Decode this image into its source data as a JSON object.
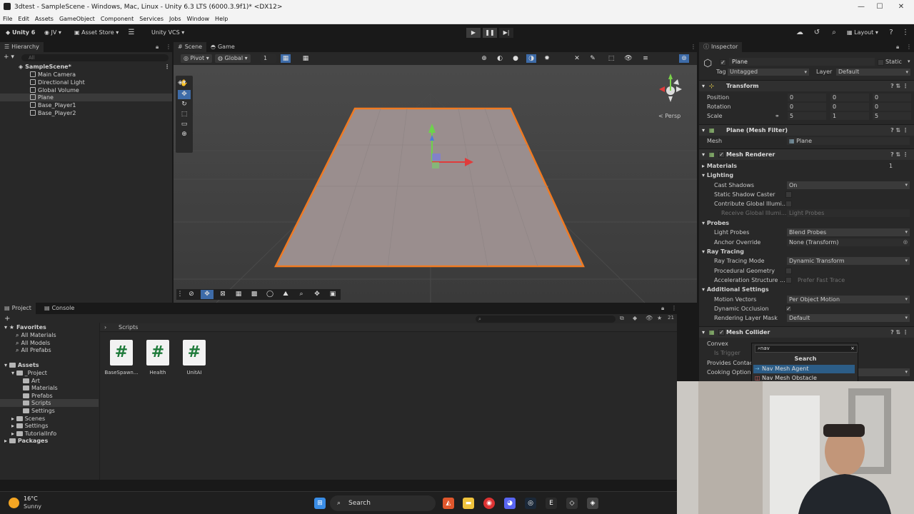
{
  "os": {
    "window_title": "3dtest - SampleScene - Windows, Mac, Linux - Unity 6.3 LTS (6000.3.9f1)* <DX12>",
    "menu": [
      "File",
      "Edit",
      "Assets",
      "GameObject",
      "Component",
      "Services",
      "Jobs",
      "Window",
      "Help"
    ]
  },
  "toolbar": {
    "unity_label": "Unity 6",
    "account_label": "JV",
    "asset_store_label": "Asset Store",
    "vcs_label": "Unity VCS",
    "layout_label": "Layout"
  },
  "hierarchy": {
    "tab_label": "Hierarchy",
    "search_placeholder": "All",
    "scene_name": "SampleScene*",
    "items": [
      "Main Camera",
      "Directional Light",
      "Global Volume",
      "Plane",
      "Base_Player1",
      "Base_Player2"
    ],
    "selected": "Plane"
  },
  "scene_view": {
    "tabs": [
      "Scene",
      "Game"
    ],
    "pivot_label": "Pivot",
    "global_label": "Global",
    "grid_count": "1",
    "persp_label": "< Persp"
  },
  "inspector": {
    "tab_label": "Inspector",
    "object_name": "Plane",
    "static_label": "Static",
    "tag_label": "Tag",
    "tag_value": "Untagged",
    "layer_label": "Layer",
    "layer_value": "Default",
    "transform": {
      "title": "Transform",
      "position_label": "Position",
      "rotation_label": "Rotation",
      "scale_label": "Scale",
      "position": [
        "0",
        "0",
        "0"
      ],
      "rotation": [
        "0",
        "0",
        "0"
      ],
      "scale": [
        "5",
        "1",
        "5"
      ]
    },
    "mesh_filter": {
      "title": "Plane (Mesh Filter)",
      "mesh_label": "Mesh",
      "mesh_value": "Plane"
    },
    "mesh_renderer": {
      "title": "Mesh Renderer",
      "materials_label": "Materials",
      "materials_count": "1",
      "lighting_label": "Lighting",
      "cast_shadows_label": "Cast Shadows",
      "cast_shadows_value": "On",
      "static_shadow_label": "Static Shadow Caster",
      "contribute_gi_label": "Contribute Global Illumi...",
      "receive_gi_label": "Receive Global Illumi...",
      "receive_gi_value": "Light Probes",
      "probes_label": "Probes",
      "light_probes_label": "Light Probes",
      "light_probes_value": "Blend Probes",
      "anchor_override_label": "Anchor Override",
      "anchor_override_value": "None (Transform)",
      "ray_tracing_label": "Ray Tracing",
      "ray_tracing_mode_label": "Ray Tracing Mode",
      "ray_tracing_mode_value": "Dynamic Transform",
      "procedural_geometry_label": "Procedural Geometry",
      "accel_structure_label": "Acceleration Structure ...",
      "accel_structure_value": "Prefer Fast Trace",
      "additional_label": "Additional Settings",
      "motion_vectors_label": "Motion Vectors",
      "motion_vectors_value": "Per Object Motion",
      "dynamic_occlusion_label": "Dynamic Occlusion",
      "rendering_layer_label": "Rendering Layer Mask",
      "rendering_layer_value": "Default"
    },
    "mesh_collider": {
      "title": "Mesh Collider",
      "convex_label": "Convex",
      "is_trigger_label": "Is Trigger",
      "provides_contacts_label": "Provides Contac...",
      "cooking_options_label": "Cooking Options"
    }
  },
  "search_popup": {
    "query": "nav",
    "title": "Search",
    "items": [
      "Nav Mesh Agent",
      "Nav Mesh Obstacle"
    ],
    "highlighted": "Nav Mesh Agent"
  },
  "project": {
    "tabs": [
      "Project",
      "Console"
    ],
    "favorites_label": "Favorites",
    "favorites": [
      "All Materials",
      "All Models",
      "All Prefabs"
    ],
    "assets_label": "Assets",
    "project_folder": "_Project",
    "project_children": [
      "Art",
      "Materials",
      "Prefabs",
      "Scripts",
      "Settings"
    ],
    "asset_folders": [
      "Scenes",
      "Settings",
      "TutorialInfo"
    ],
    "packages_label": "Packages",
    "breadcrumb": "Scripts",
    "scripts": [
      "BaseSpawn...",
      "Health",
      "UnitAI"
    ],
    "count_label": "21"
  },
  "taskbar": {
    "temperature": "16°C",
    "weather": "Sunny",
    "search_label": "Search"
  }
}
